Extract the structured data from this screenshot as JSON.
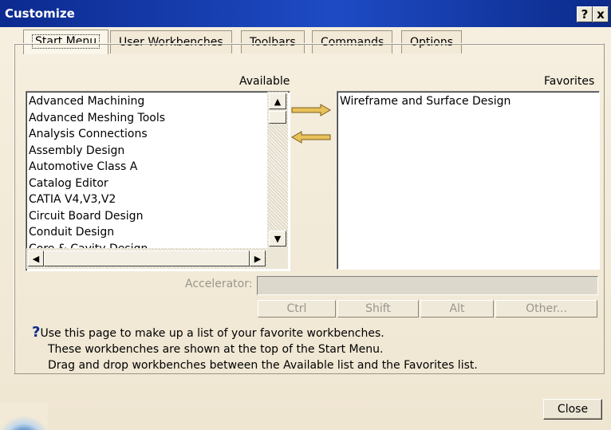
{
  "window": {
    "title": "Customize",
    "help_btn": "?",
    "close_btn": "x"
  },
  "tabs": [
    {
      "label": "Start Menu"
    },
    {
      "label": "User Workbenches"
    },
    {
      "label": "Toolbars"
    },
    {
      "label": "Commands"
    },
    {
      "label": "Options"
    }
  ],
  "available": {
    "label": "Available",
    "items": [
      "Advanced Machining",
      "Advanced Meshing Tools",
      "Analysis Connections",
      "Assembly Design",
      "Automotive Class A",
      "Catalog Editor",
      "CATIA V4,V3,V2",
      "Circuit Board Design",
      "Conduit Design",
      "Core & Cavity Design"
    ]
  },
  "favorites": {
    "label": "Favorites",
    "items": [
      "Wireframe and Surface Design"
    ]
  },
  "accelerator": {
    "label": "Accelerator:",
    "value": ""
  },
  "modifiers": {
    "ctrl": "Ctrl",
    "shift": "Shift",
    "alt": "Alt",
    "other": "Other..."
  },
  "help": {
    "lines": [
      "Use this page to make up a list of your favorite workbenches.",
      "These workbenches are shown at the top of the Start Menu.",
      "Drag and drop workbenches between the Available list and the Favorites list."
    ]
  },
  "buttons": {
    "close": "Close"
  },
  "colors": {
    "titlebar": "#0c2a8f",
    "arrows": "#e8c15a"
  }
}
